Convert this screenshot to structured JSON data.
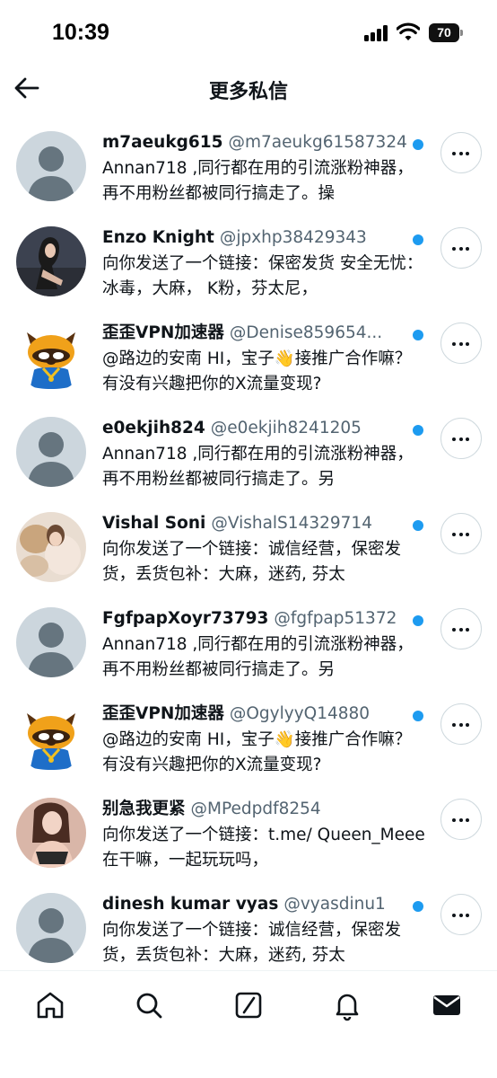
{
  "status_bar": {
    "time": "10:39",
    "battery": "70"
  },
  "header": {
    "title": "更多私信"
  },
  "colors": {
    "accent": "#1d9bf0",
    "text": "#0f1419",
    "secondary": "#536471"
  },
  "messages": [
    {
      "name": "m7aeukg615",
      "handle": "@m7aeukg61587324",
      "preview": "Annan718 ,同行都在用的引流涨粉神器，再不用粉丝都被同行搞走了。操",
      "avatar": "default-avatar",
      "unread": true
    },
    {
      "name": "Enzo Knight",
      "handle": "@jpxhp38429343",
      "preview": "向你发送了一个链接：保密发货 安全无忧： 冰毒，大麻， K粉，芬太尼，",
      "avatar": "photo-avatar-dark",
      "unread": true
    },
    {
      "name": "歪歪VPN加速器",
      "handle": "@Denise859654...",
      "preview": "@路边的安南 HI，宝子👋接推广合作嘛？有没有兴趣把你的X流量变现?",
      "avatar": "raccoon-avatar",
      "unread": true
    },
    {
      "name": "e0ekjih824",
      "handle": "@e0ekjih8241205",
      "preview": "Annan718 ,同行都在用的引流涨粉神器，再不用粉丝都被同行搞走了。另",
      "avatar": "default-avatar",
      "unread": true
    },
    {
      "name": "Vishal Soni",
      "handle": "@VishalS14329714",
      "preview": "向你发送了一个链接：诚信经营，保密发货，丢货包补：大麻，迷药, 芬太",
      "avatar": "photo-avatar-light",
      "unread": true
    },
    {
      "name": "FgfpapXoyr73793",
      "handle": "@fgfpap51372",
      "preview": "Annan718 ,同行都在用的引流涨粉神器，再不用粉丝都被同行搞走了。另",
      "avatar": "default-avatar",
      "unread": true
    },
    {
      "name": "歪歪VPN加速器",
      "handle": "@OgylyyQ14880",
      "preview": "@路边的安南 HI，宝子👋接推广合作嘛？有没有兴趣把你的X流量变现?",
      "avatar": "raccoon-avatar",
      "unread": true
    },
    {
      "name": "别急我更紧",
      "handle": "@MPedpdf8254",
      "preview": "向你发送了一个链接：t.me/ Queen_Meee 在干嘛，一起玩玩吗，",
      "avatar": "photo-avatar-pink",
      "unread": false
    },
    {
      "name": "dinesh kumar vyas",
      "handle": "@vyasdinu1",
      "preview": "向你发送了一个链接：诚信经营，保密发货，丢货包补：大麻，迷药, 芬太",
      "avatar": "default-avatar",
      "unread": true
    }
  ],
  "nav": [
    "home-icon",
    "search-icon",
    "grok-icon",
    "notifications-icon",
    "messages-icon"
  ]
}
